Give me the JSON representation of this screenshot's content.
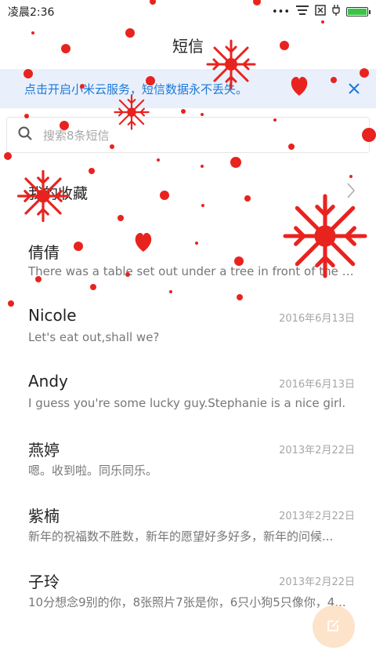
{
  "status_bar": {
    "time": "凌晨2:36",
    "dots_icon": "more-dots-icon",
    "notification_icon": "notification-icon",
    "sim_icon": "no-sim-icon",
    "charging_icon": "charging-icon",
    "battery_level": 1.0,
    "battery_color": "#3cc24a"
  },
  "header": {
    "title": "短信"
  },
  "cloud_banner": {
    "text": "点击开启小米云服务，短信数据永不丢失。",
    "close_icon": "close-icon",
    "background": "#e9f0fc",
    "text_color": "#1d78d6"
  },
  "search": {
    "placeholder": "搜索8条短信",
    "icon": "search-icon"
  },
  "favorites": {
    "label": "我的收藏",
    "icon": "chevron-right-icon"
  },
  "messages": [
    {
      "name": "倩倩",
      "date": "",
      "preview": "There was a table set out under a tree in front of the ho..."
    },
    {
      "name": "Nicole",
      "date": "2016年6月13日",
      "preview": "Let's eat out,shall we?"
    },
    {
      "name": "Andy",
      "date": "2016年6月13日",
      "preview": "I guess you're some lucky guy.Stephanie is a nice girl."
    },
    {
      "name": "燕婷",
      "date": "2013年2月22日",
      "preview": "嗯。收到啦。同乐同乐。"
    },
    {
      "name": "紫楠",
      "date": "2013年2月22日",
      "preview": "新年的祝福数不胜数，新年的愿望好多好多，新年的问候..."
    },
    {
      "name": "子玲",
      "date": "2013年2月22日",
      "preview": "10分想念9别的你，8张照片7张是你，6只小狗5只像你，4..."
    }
  ],
  "compose_button": {
    "icon": "compose-icon",
    "color": "#fde3c9"
  },
  "decoration": {
    "snow_color": "#e8231f"
  }
}
